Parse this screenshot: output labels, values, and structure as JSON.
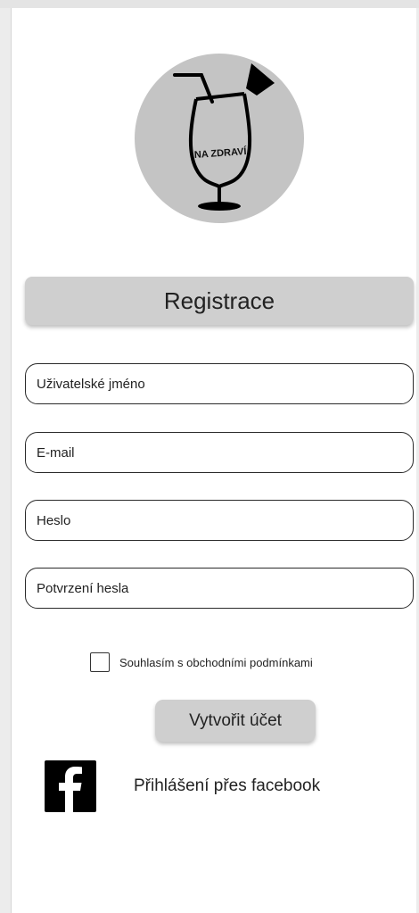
{
  "logo": {
    "text": "NA ZDRAVÍ",
    "icon": "cocktail-glass-icon"
  },
  "header": {
    "title": "Registrace"
  },
  "form": {
    "username_placeholder": "Uživatelské jméno",
    "email_placeholder": "E-mail",
    "password_placeholder": "Heslo",
    "confirm_placeholder": "Potvrzení hesla",
    "terms_label": "Souhlasím s obchodními podmínkami",
    "terms_checked": false,
    "submit_label": "Vytvořit účet"
  },
  "facebook": {
    "label": "Přihlášení přes facebook",
    "icon": "facebook-icon"
  },
  "colors": {
    "bar_gray": "#cfcfcf",
    "logo_circle": "#c4c4c4",
    "border": "#2a2a2a"
  }
}
